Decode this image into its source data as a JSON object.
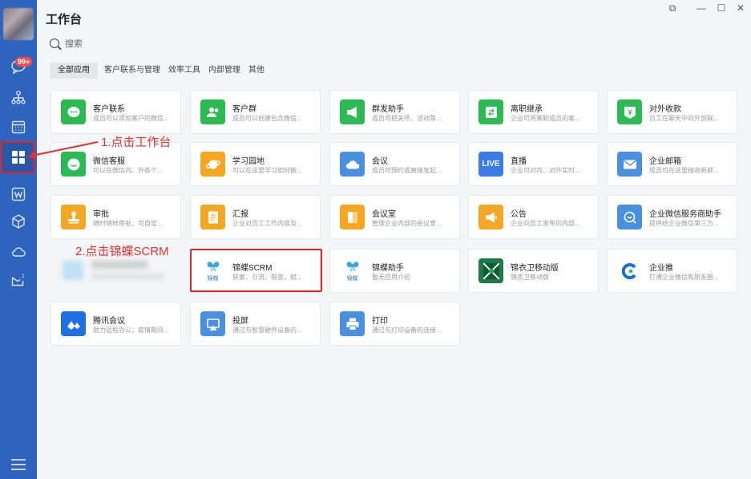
{
  "app": {
    "title": "工作台"
  },
  "window_controls": [
    "⧉",
    "—",
    "☐",
    "✕"
  ],
  "sidebar": {
    "badge": "99+",
    "items": [
      {
        "name": "chat-icon"
      },
      {
        "name": "contacts-icon"
      },
      {
        "name": "calendar-icon"
      },
      {
        "name": "workbench-icon"
      },
      {
        "name": "doc-icon"
      },
      {
        "name": "cube-icon"
      },
      {
        "name": "cloud-icon"
      },
      {
        "name": "mail-icon"
      }
    ]
  },
  "search": {
    "placeholder": "搜索"
  },
  "tabs": [
    {
      "label": "全部应用",
      "active": true
    },
    {
      "label": "客户联系与管理"
    },
    {
      "label": "效率工具"
    },
    {
      "label": "内部管理"
    },
    {
      "label": "其他"
    }
  ],
  "apps": [
    {
      "name": "客户联系",
      "desc": "成员可以添加客户的微信...",
      "color": "#2cba52",
      "icon": "chat-bubble-icon"
    },
    {
      "name": "客户群",
      "desc": "成员可以创建包含微信...",
      "color": "#2cba52",
      "icon": "group-icon"
    },
    {
      "name": "群发助手",
      "desc": "成员可把关怀、活动等...",
      "color": "#2cba52",
      "icon": "megaphone-icon"
    },
    {
      "name": "离职继承",
      "desc": "企业可将离职成员的客...",
      "color": "#2cba52",
      "icon": "transfer-icon"
    },
    {
      "name": "对外收款",
      "desc": "员工在聊天中向外部联...",
      "color": "#2cba52",
      "icon": "yen-icon"
    },
    {
      "name": "微信客服",
      "desc": "可以在微信内、外各个...",
      "color": "#2cba52",
      "icon": "service-icon"
    },
    {
      "name": "学习园地",
      "desc": "可以在这里学习如何做...",
      "color": "#f5a623",
      "icon": "planet-icon"
    },
    {
      "name": "会议",
      "desc": "成员可预约或直接发起...",
      "color": "#4a90e2",
      "icon": "cloud-meeting-icon"
    },
    {
      "name": "直播",
      "desc": "企业可对内、对外实时...",
      "color": "#3b7be8",
      "icon": "live-icon",
      "label": "LIVE"
    },
    {
      "name": "企业邮箱",
      "desc": "成员可在这里接收新邮...",
      "color": "#4a90e2",
      "icon": "envelope-icon"
    },
    {
      "name": "审批",
      "desc": "随时随地审批，可自定...",
      "color": "#f5a623",
      "icon": "stamp-icon"
    },
    {
      "name": "汇报",
      "desc": "企业对员工工作内容及...",
      "color": "#f5a623",
      "icon": "report-icon"
    },
    {
      "name": "会议室",
      "desc": "管理企业内部的会议室...",
      "color": "#f5a623",
      "icon": "door-icon"
    },
    {
      "name": "公告",
      "desc": "企业向员工发布的内部...",
      "color": "#f5a623",
      "icon": "announce-icon"
    },
    {
      "name": "企业微信服务商助手",
      "desc": "提供给企业微信第三方...",
      "color": "#4a90e2",
      "icon": "assistant-icon"
    },
    {
      "name": "锦蝶SCRM",
      "desc": "获客、引流、裂变，赋...",
      "color": "#ffffff",
      "icon": "butterfly-icon",
      "label": "锦蝶"
    },
    {
      "name": "锦蝶助手",
      "desc": "暂无应用介绍",
      "color": "#ffffff",
      "icon": "butterfly-icon",
      "label": "锦蝶"
    },
    {
      "name": "锦衣卫移动版",
      "desc": "锦衣卫移动版",
      "color": "#1e7a46",
      "icon": "jinyiwei-icon"
    },
    {
      "name": "企业推",
      "desc": "打通企业微信和朋友圈...",
      "color": "#ffffff",
      "icon": "qiyetui-icon"
    },
    {
      "name": "腾讯会议",
      "desc": "助力远程办公，疫情期间...",
      "color": "#1f6fe5",
      "icon": "tencent-meeting-icon"
    },
    {
      "name": "投屏",
      "desc": "通过与智慧硬件设备的...",
      "color": "#4a90e2",
      "icon": "screen-cast-icon"
    },
    {
      "name": "打印",
      "desc": "通过与打印设备的连接...",
      "color": "#4a90e2",
      "icon": "printer-icon"
    }
  ],
  "annotations": {
    "step1": "1.点击工作台",
    "step2": "2.点击锦蝶SCRM"
  }
}
